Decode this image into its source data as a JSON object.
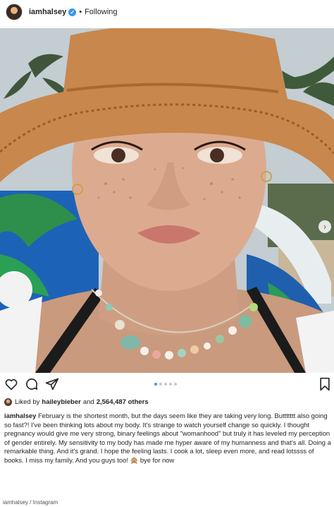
{
  "header": {
    "username": "iamhalsey",
    "verified_mark": "✓",
    "separator": "•",
    "follow_status": "Following"
  },
  "post": {
    "carousel": {
      "slides": 5,
      "active_index": 0,
      "next_arrow": "›"
    }
  },
  "actions": {
    "icons": [
      "heart-icon",
      "comment-icon",
      "share-icon",
      "bookmark-icon"
    ]
  },
  "likes": {
    "prefix": "Liked by",
    "first_liker": "haileybieber",
    "connector": "and",
    "others": "2,564,487 others"
  },
  "caption": {
    "username": "iamhalsey",
    "text": " February is the shortest month, but the days seem like they are taking very long. Buttttttt also going so fast?! I've been thinking lots about my body. It's strange to watch yourself change so quickly. I thought pregnancy would give me very strong, binary feelings about \"womanhood\" but truly it has leveled my perception of gender entirely. My sensitivity to my body has made me hyper aware of my humanness and that's all. Doing a remarkable thing. And it's grand. I hope the feeling lasts. I cook a lot, sleep even more, and read lotssss of books. I miss my family. And you guys too! 🙊 bye for now"
  },
  "credit": "iamhalsey / Instagram",
  "colors": {
    "accent": "#3897f0",
    "text": "#262626",
    "hat": "#c8874c"
  }
}
